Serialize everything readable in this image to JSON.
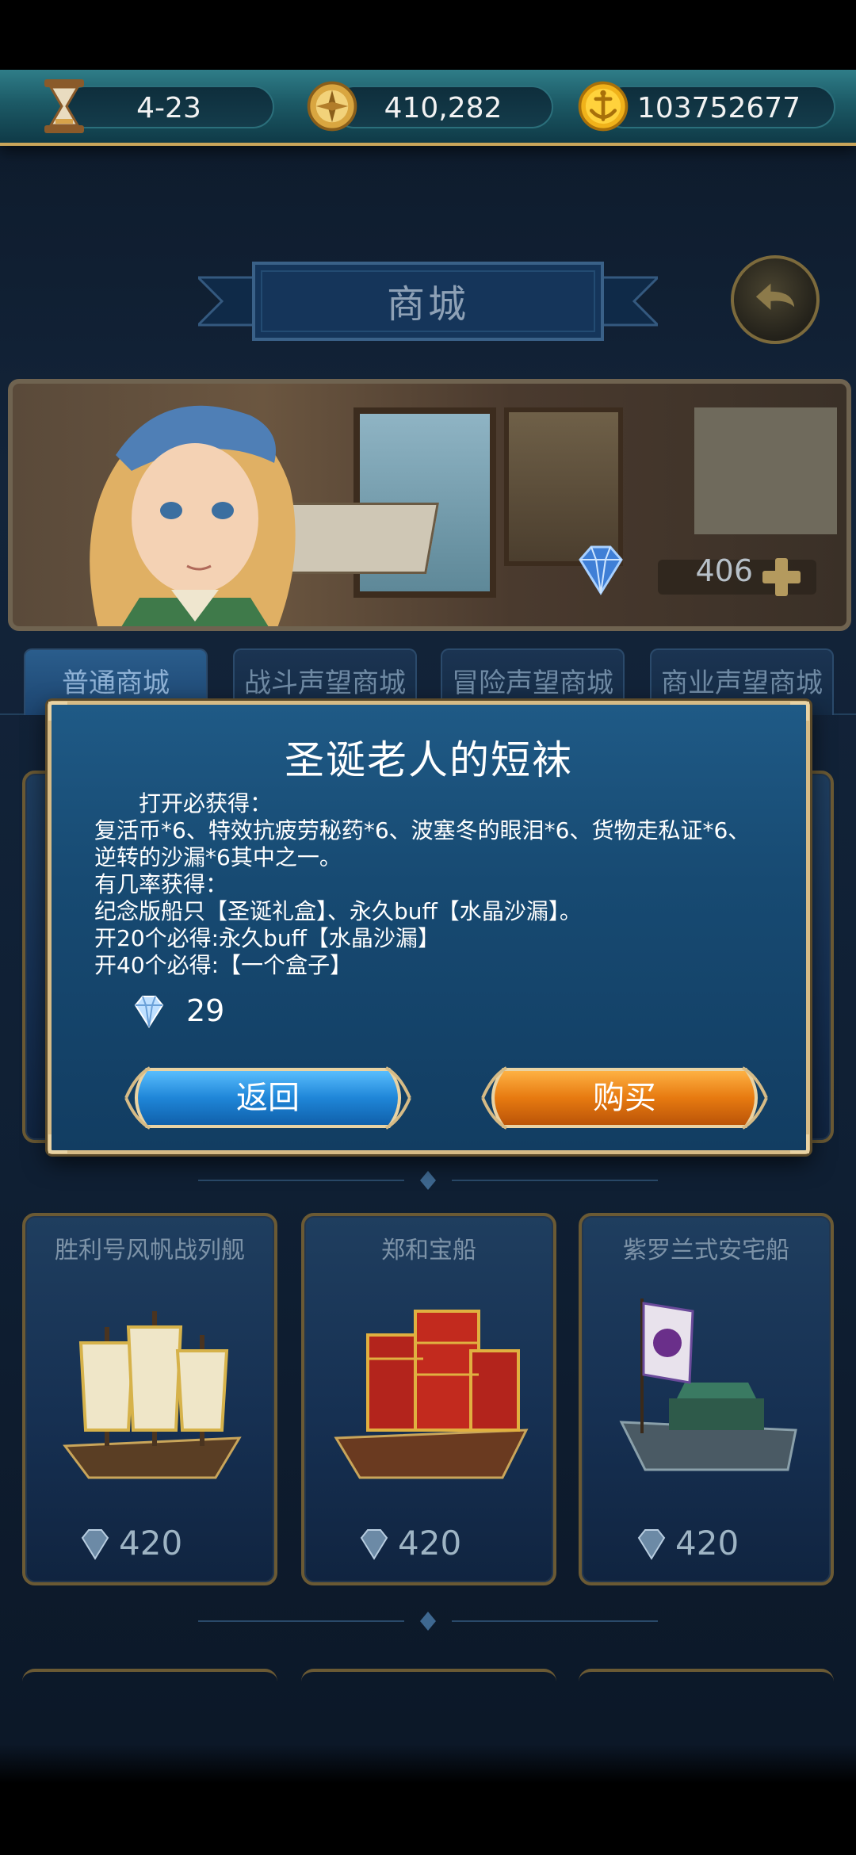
{
  "resources": {
    "turn": "4-23",
    "coins": "410,282",
    "gold": "103752677"
  },
  "shop": {
    "title": "商城",
    "gem_balance": "406"
  },
  "tabs": [
    {
      "label": "普通商城",
      "active": true
    },
    {
      "label": "战斗声望商城",
      "active": false
    },
    {
      "label": "冒险声望商城",
      "active": false
    },
    {
      "label": "商业声望商城",
      "active": false
    }
  ],
  "cards_row2": [
    {
      "name": "胜利号风帆战列舰",
      "price": "420"
    },
    {
      "name": "郑和宝船",
      "price": "420"
    },
    {
      "name": "紫罗兰式安宅船",
      "price": "420"
    }
  ],
  "dialog": {
    "title": "圣诞老人的短袜",
    "lines": [
      "打开必获得：",
      "复活币*6、特效抗疲劳秘药*6、波塞冬的眼泪*6、货物走私证*6、",
      "逆转的沙漏*6其中之一。",
      "有几率获得：",
      "纪念版船只【圣诞礼盒】、永久buff【水晶沙漏】。",
      "开20个必得:永久buff【水晶沙漏】",
      "开40个必得:【一个盒子】"
    ],
    "price": "29",
    "back_label": "返回",
    "buy_label": "购买"
  },
  "colors": {
    "accent_gold": "#d6bb86",
    "dialog_blue": "#174a72",
    "back_blue": "#2a8ee0",
    "buy_orange": "#e77a10"
  },
  "icons": {
    "turn": "hourglass-icon",
    "coins": "compass-coin-icon",
    "gold": "anchor-coin-icon",
    "gem": "diamond-icon",
    "back": "return-arrow-icon",
    "plus": "plus-icon"
  }
}
